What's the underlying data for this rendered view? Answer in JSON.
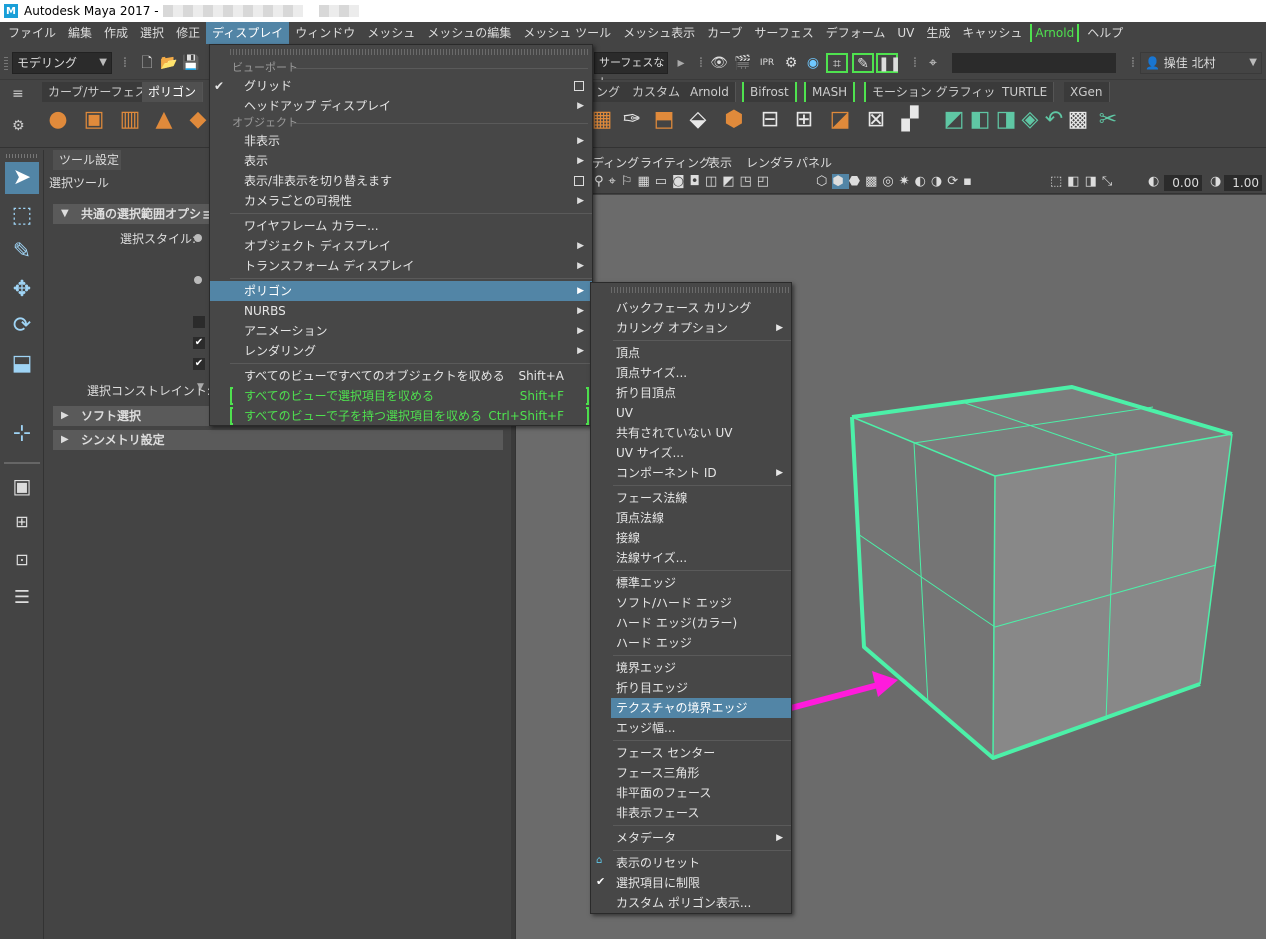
{
  "window": {
    "title": "Autodesk Maya 2017 -"
  },
  "menubar": {
    "items": [
      "ファイル",
      "編集",
      "作成",
      "選択",
      "修正",
      "ディスプレイ",
      "ウィンドウ",
      "メッシュ",
      "メッシュの編集",
      "メッシュ ツール",
      "メッシュ表示",
      "カーブ",
      "サーフェス",
      "デフォーム",
      "UV",
      "生成",
      "キャッシュ",
      "Arnold",
      "ヘルプ"
    ],
    "active_index": 5
  },
  "statusline": {
    "mode": "モデリング",
    "surface_filter": "サーフェスなし",
    "user": "操佳 北村"
  },
  "shelf": {
    "tabs": [
      "カーブ/サーフェス",
      "ポリゴン",
      "ング",
      "カスタム",
      "Arnold",
      "Bifrost",
      "MASH",
      "モーション グラフィックス",
      "TURTLE",
      "XGen"
    ],
    "selected_index": 1
  },
  "tool_settings": {
    "tab": "ツール設定",
    "tool_name": "選択ツール",
    "section_common": "共通の選択範囲オプション",
    "select_style_label": "選択スタイル:",
    "constraint_label": "選択コンストレイント:",
    "section_soft": "ソフト選択",
    "section_symmetry": "シンメトリ設定"
  },
  "viewport": {
    "menus": [
      "ディング",
      "ライティング",
      "表示",
      "レンダラ",
      "パネル"
    ],
    "field_a": "0.00",
    "field_b": "1.00"
  },
  "display_menu": {
    "heading_viewport": "ビューポート",
    "heading_object": "オブジェクト",
    "items": {
      "grid": "グリッド",
      "hud": "ヘッドアップ ディスプレイ",
      "hide": "非表示",
      "show": "表示",
      "toggle": "表示/非表示を切り替えます",
      "per_camera": "カメラごとの可視性",
      "wire_color": "ワイヤフレーム カラー...",
      "obj_display": "オブジェクト ディスプレイ",
      "transform_display": "トランスフォーム ディスプレイ",
      "polygon": "ポリゴン",
      "nurbs": "NURBS",
      "animation": "アニメーション",
      "rendering": "レンダリング",
      "frame_all": "すべてのビューですべてのオブジェクトを収める",
      "frame_sel": "すべてのビューで選択項目を収める",
      "frame_sel_children": "すべてのビューで子を持つ選択項目を収める"
    },
    "shortcuts": {
      "frame_all": "Shift+A",
      "frame_sel": "Shift+F",
      "frame_sel_children": "Ctrl+Shift+F"
    }
  },
  "polygon_menu": {
    "items": {
      "backface": "バックフェース カリング",
      "culling_options": "カリング オプション",
      "vertices": "頂点",
      "vertex_size": "頂点サイズ...",
      "crease_vertices": "折り目頂点",
      "uv": "UV",
      "unshared_uv": "共有されていない UV",
      "uv_size": "UV サイズ...",
      "component_id": "コンポーネント ID",
      "face_normals": "フェース法線",
      "vertex_normals": "頂点法線",
      "tangents": "接線",
      "normal_size": "法線サイズ...",
      "std_edges": "標準エッジ",
      "soft_hard": "ソフト/ハード エッジ",
      "hard_color": "ハード エッジ(カラー)",
      "hard_edges": "ハード エッジ",
      "border_edges": "境界エッジ",
      "crease_edges": "折り目エッジ",
      "texture_border": "テクスチャの境界エッジ",
      "edge_width": "エッジ幅...",
      "face_centers": "フェース センター",
      "face_triangles": "フェース三角形",
      "nonplanar": "非平面のフェース",
      "hidden_faces": "非表示フェース",
      "metadata": "メタデータ",
      "reset_display": "表示のリセット",
      "limit_selection": "選択項目に制限",
      "custom_display": "カスタム ポリゴン表示..."
    }
  },
  "colors": {
    "highlight": "#5285a6",
    "arnold_green": "#4fe24f",
    "cube_edge": "#4cf0a8",
    "annotation_arrow": "#ff1bdc"
  }
}
